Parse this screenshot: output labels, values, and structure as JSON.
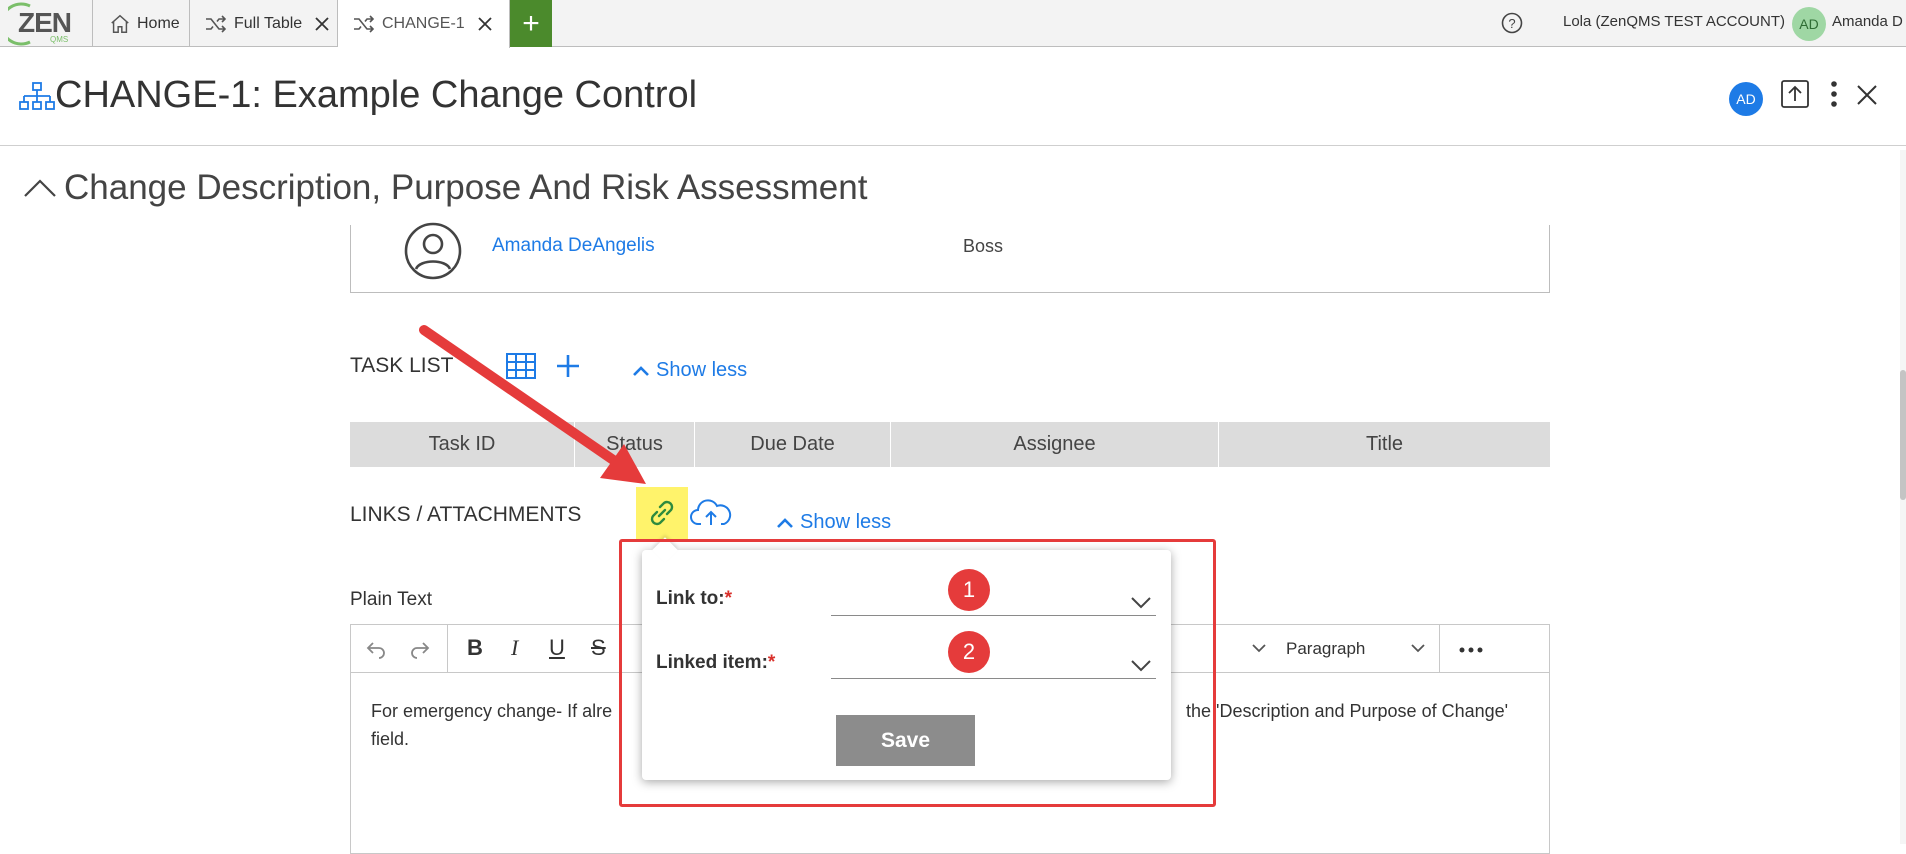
{
  "topbar": {
    "logo_text": "ZEN",
    "logo_sub": "QMS",
    "tabs": [
      {
        "label": "Home",
        "icon": "home-icon"
      },
      {
        "label": "Full Table",
        "icon": "shuffle-icon"
      },
      {
        "label": "CHANGE-1",
        "icon": "shuffle-icon"
      }
    ],
    "new_tab_label": "+",
    "account": "Lola (ZenQMS TEST ACCOUNT)",
    "user_initials": "AD",
    "user_name": "Amanda D"
  },
  "header": {
    "title": "CHANGE-1: Example Change Control",
    "avatar_initials": "AD"
  },
  "section": {
    "title": "Change Description, Purpose And Risk Assessment",
    "person_name": "Amanda DeAngelis",
    "person_role": "Boss"
  },
  "task_list": {
    "label": "TASK LIST",
    "show_less": "Show less",
    "columns": [
      "Task ID",
      "Status",
      "Due Date",
      "Assignee",
      "Title"
    ]
  },
  "links": {
    "label": "LINKS / ATTACHMENTS",
    "show_less": "Show less"
  },
  "popup": {
    "link_to_label": "Link to:",
    "linked_item_label": "Linked item:",
    "required_mark": "*",
    "link_to_value": "",
    "linked_item_value": "",
    "save_label": "Save"
  },
  "annotations": {
    "badge_1": "1",
    "badge_2": "2",
    "accent_color": "#e53b3b",
    "highlight_color": "#fff36b"
  },
  "plain_text": {
    "label": "Plain Text",
    "block_format": "Paragraph",
    "content_left": "For emergency change- If alre",
    "content_right": "the 'Description and Purpose of Change'",
    "content_line2": "field."
  },
  "colors": {
    "brand_link": "#1e7be6",
    "new_tab": "#4b8a2c",
    "save_disabled": "#8c8c8c"
  }
}
